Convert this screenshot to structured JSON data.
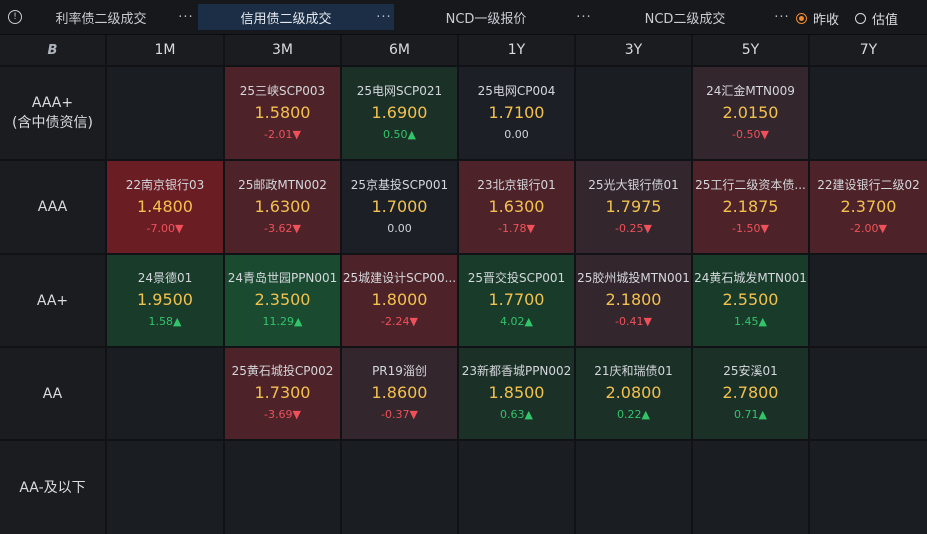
{
  "top_tabs": [
    {
      "label": "利率债二级成交",
      "active": false
    },
    {
      "label": "信用债二级成交",
      "active": true
    },
    {
      "label": "NCD一级报价",
      "active": false
    },
    {
      "label": "NCD二级成交",
      "active": false
    }
  ],
  "more_glyph": "···",
  "info_glyph": "!",
  "radio_options": [
    {
      "label": "昨收",
      "selected": true
    },
    {
      "label": "估值",
      "selected": false
    }
  ],
  "grid": {
    "corner_logo": "B",
    "columns": [
      "1M",
      "3M",
      "6M",
      "1Y",
      "3Y",
      "5Y",
      "7Y"
    ],
    "rows": [
      {
        "label": "AAA+\n(含中债资信)",
        "cells": [
          null,
          {
            "name": "25三峡SCP003",
            "yield": "1.5800",
            "change": "-2.01▼",
            "dir": "down"
          },
          {
            "name": "25电网SCP021",
            "yield": "1.6900",
            "change": "0.50▲",
            "dir": "up"
          },
          {
            "name": "25电网CP004",
            "yield": "1.7100",
            "change": "0.00",
            "dir": "flat"
          },
          null,
          {
            "name": "24汇金MTN009",
            "yield": "2.0150",
            "change": "-0.50▼",
            "dir": "down"
          },
          null
        ]
      },
      {
        "label": "AAA",
        "cells": [
          {
            "name": "22南京银行03",
            "yield": "1.4800",
            "change": "-7.00▼",
            "dir": "down"
          },
          {
            "name": "25邮政MTN002",
            "yield": "1.6300",
            "change": "-3.62▼",
            "dir": "down"
          },
          {
            "name": "25京基投SCP001",
            "yield": "1.7000",
            "change": "0.00",
            "dir": "flat"
          },
          {
            "name": "23北京银行01",
            "yield": "1.6300",
            "change": "-1.78▼",
            "dir": "down"
          },
          {
            "name": "25光大银行债01",
            "yield": "1.7975",
            "change": "-0.25▼",
            "dir": "down"
          },
          {
            "name": "25工行二级资本债...",
            "yield": "2.1875",
            "change": "-1.50▼",
            "dir": "down"
          },
          {
            "name": "22建设银行二级02",
            "yield": "2.3700",
            "change": "-2.00▼",
            "dir": "down"
          }
        ]
      },
      {
        "label": "AA+",
        "cells": [
          {
            "name": "24景德01",
            "yield": "1.9500",
            "change": "1.58▲",
            "dir": "up"
          },
          {
            "name": "24青岛世园PPN001",
            "yield": "2.3500",
            "change": "11.29▲",
            "dir": "up"
          },
          {
            "name": "25城建设计SCP00...",
            "yield": "1.8000",
            "change": "-2.24▼",
            "dir": "down"
          },
          {
            "name": "25晋交投SCP001",
            "yield": "1.7700",
            "change": "4.02▲",
            "dir": "up"
          },
          {
            "name": "25胶州城投MTN001",
            "yield": "2.1800",
            "change": "-0.41▼",
            "dir": "down"
          },
          {
            "name": "24黄石城发MTN001",
            "yield": "2.5500",
            "change": "1.45▲",
            "dir": "up"
          },
          null
        ]
      },
      {
        "label": "AA",
        "cells": [
          null,
          {
            "name": "25黄石城投CP002",
            "yield": "1.7300",
            "change": "-3.69▼",
            "dir": "down"
          },
          {
            "name": "PR19淄创",
            "yield": "1.8600",
            "change": "-0.37▼",
            "dir": "down"
          },
          {
            "name": "23新都香城PPN002",
            "yield": "1.8500",
            "change": "0.63▲",
            "dir": "up"
          },
          {
            "name": "21庆和瑞债01",
            "yield": "2.0800",
            "change": "0.22▲",
            "dir": "up"
          },
          {
            "name": "25安溪01",
            "yield": "2.7800",
            "change": "0.71▲",
            "dir": "up"
          },
          null
        ]
      },
      {
        "label": "AA-及以下",
        "cells": [
          null,
          null,
          null,
          null,
          null,
          null,
          null
        ]
      }
    ]
  },
  "colors": {
    "empty": "#1a1d22",
    "flat": "#1c2026",
    "down_strong": "#6a1e24",
    "down_mid": "#4d2329",
    "down_light": "#33262c",
    "up_strong": "#1a4a30",
    "up_mid": "#183b2a",
    "up_light": "#1b3027",
    "yield": "#f2c14e",
    "accent": "#f08a2c"
  }
}
